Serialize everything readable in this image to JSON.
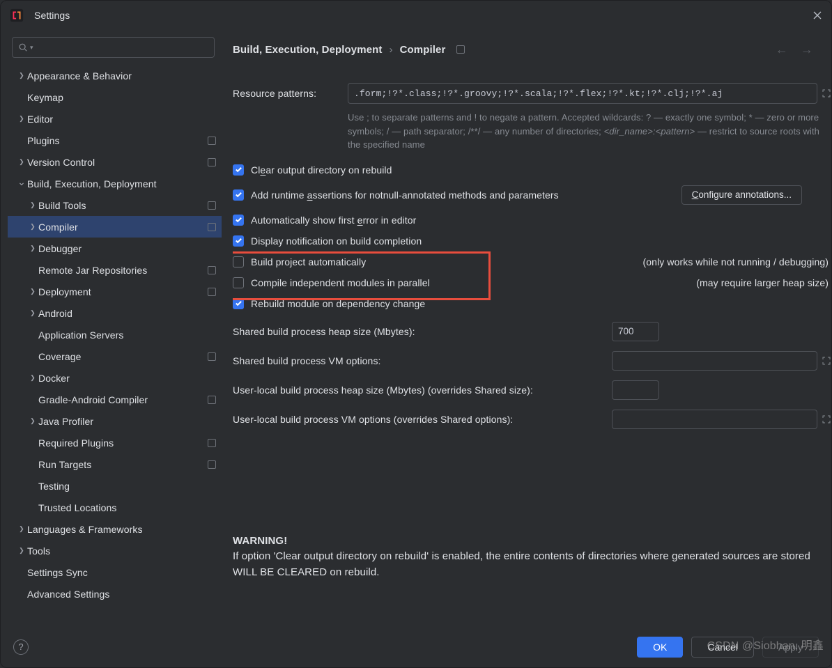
{
  "title": "Settings",
  "search_placeholder": "",
  "tree": [
    {
      "label": "Appearance & Behavior",
      "depth": 0,
      "arrow": ">"
    },
    {
      "label": "Keymap",
      "depth": 0
    },
    {
      "label": "Editor",
      "depth": 0,
      "arrow": ">"
    },
    {
      "label": "Plugins",
      "depth": 0,
      "sq": true
    },
    {
      "label": "Version Control",
      "depth": 0,
      "arrow": ">",
      "sq": true
    },
    {
      "label": "Build, Execution, Deployment",
      "depth": 0,
      "arrow": "v"
    },
    {
      "label": "Build Tools",
      "depth": 1,
      "arrow": ">",
      "sq": true
    },
    {
      "label": "Compiler",
      "depth": 1,
      "arrow": ">",
      "sq": true,
      "sel": true
    },
    {
      "label": "Debugger",
      "depth": 1,
      "arrow": ">"
    },
    {
      "label": "Remote Jar Repositories",
      "depth": 1,
      "sq": true
    },
    {
      "label": "Deployment",
      "depth": 1,
      "arrow": ">",
      "sq": true
    },
    {
      "label": "Android",
      "depth": 1,
      "arrow": ">"
    },
    {
      "label": "Application Servers",
      "depth": 1
    },
    {
      "label": "Coverage",
      "depth": 1,
      "sq": true
    },
    {
      "label": "Docker",
      "depth": 1,
      "arrow": ">"
    },
    {
      "label": "Gradle-Android Compiler",
      "depth": 1,
      "sq": true
    },
    {
      "label": "Java Profiler",
      "depth": 1,
      "arrow": ">"
    },
    {
      "label": "Required Plugins",
      "depth": 1,
      "sq": true
    },
    {
      "label": "Run Targets",
      "depth": 1,
      "sq": true
    },
    {
      "label": "Testing",
      "depth": 1
    },
    {
      "label": "Trusted Locations",
      "depth": 1
    },
    {
      "label": "Languages & Frameworks",
      "depth": 0,
      "arrow": ">"
    },
    {
      "label": "Tools",
      "depth": 0,
      "arrow": ">"
    },
    {
      "label": "Settings Sync",
      "depth": 0
    },
    {
      "label": "Advanced Settings",
      "depth": 0
    }
  ],
  "breadcrumb": {
    "a": "Build, Execution, Deployment",
    "b": "Compiler"
  },
  "resource_patterns_label": "Resource patterns:",
  "resource_patterns_value": ".form;!?*.class;!?*.groovy;!?*.scala;!?*.flex;!?*.kt;!?*.clj;!?*.aj",
  "hint_pre": "Use ; to separate patterns and ! to negate a pattern. Accepted wildcards: ? — exactly one symbol; * — zero or more symbols; / — path separator; /**/ — any number of directories; ",
  "hint_mid": "<dir_name>:<pattern>",
  "hint_post": " — restrict to source roots with the specified name",
  "checks": [
    {
      "on": true,
      "pre": "Cl",
      "u": "e",
      "post": "ar output directory on rebuild"
    },
    {
      "on": true,
      "pre": "Add runtime ",
      "u": "a",
      "post": "ssertions for notnull-annotated methods and parameters",
      "btn": "Configure annotations...",
      "btnU": "C"
    },
    {
      "on": true,
      "pre": "Automatically show first ",
      "u": "e",
      "post": "rror in editor"
    },
    {
      "on": true,
      "pre": "Display notification on build completion"
    },
    {
      "on": false,
      "pre": "Build project automatically",
      "note": "(only works while not running / debugging)",
      "hl": true
    },
    {
      "on": false,
      "pre": "Compile independent modules in parallel",
      "note": "(may require larger heap size)",
      "hl_cont": true
    },
    {
      "on": true,
      "pre": "Rebuild module on dependency change"
    }
  ],
  "fields": [
    {
      "label": "Shared build process heap size (Mbytes):",
      "value": "700",
      "w": "num"
    },
    {
      "label": "Shared build process VM options:",
      "value": "",
      "w": "wide",
      "exp": true
    },
    {
      "label": "User-local build process heap size (Mbytes) (overrides Shared size):",
      "value": "",
      "w": "num"
    },
    {
      "label": "User-local build process VM options (overrides Shared options):",
      "value": "",
      "w": "wide",
      "exp": true
    }
  ],
  "warning_title": "WARNING!",
  "warning_body": "If option 'Clear output directory on rebuild' is enabled, the entire contents of directories where generated sources are stored WILL BE CLEARED on rebuild.",
  "buttons": {
    "ok": "OK",
    "cancel": "Cancel",
    "apply": "Apply"
  },
  "watermark": "CSDN @Siobhan. 明鑫"
}
